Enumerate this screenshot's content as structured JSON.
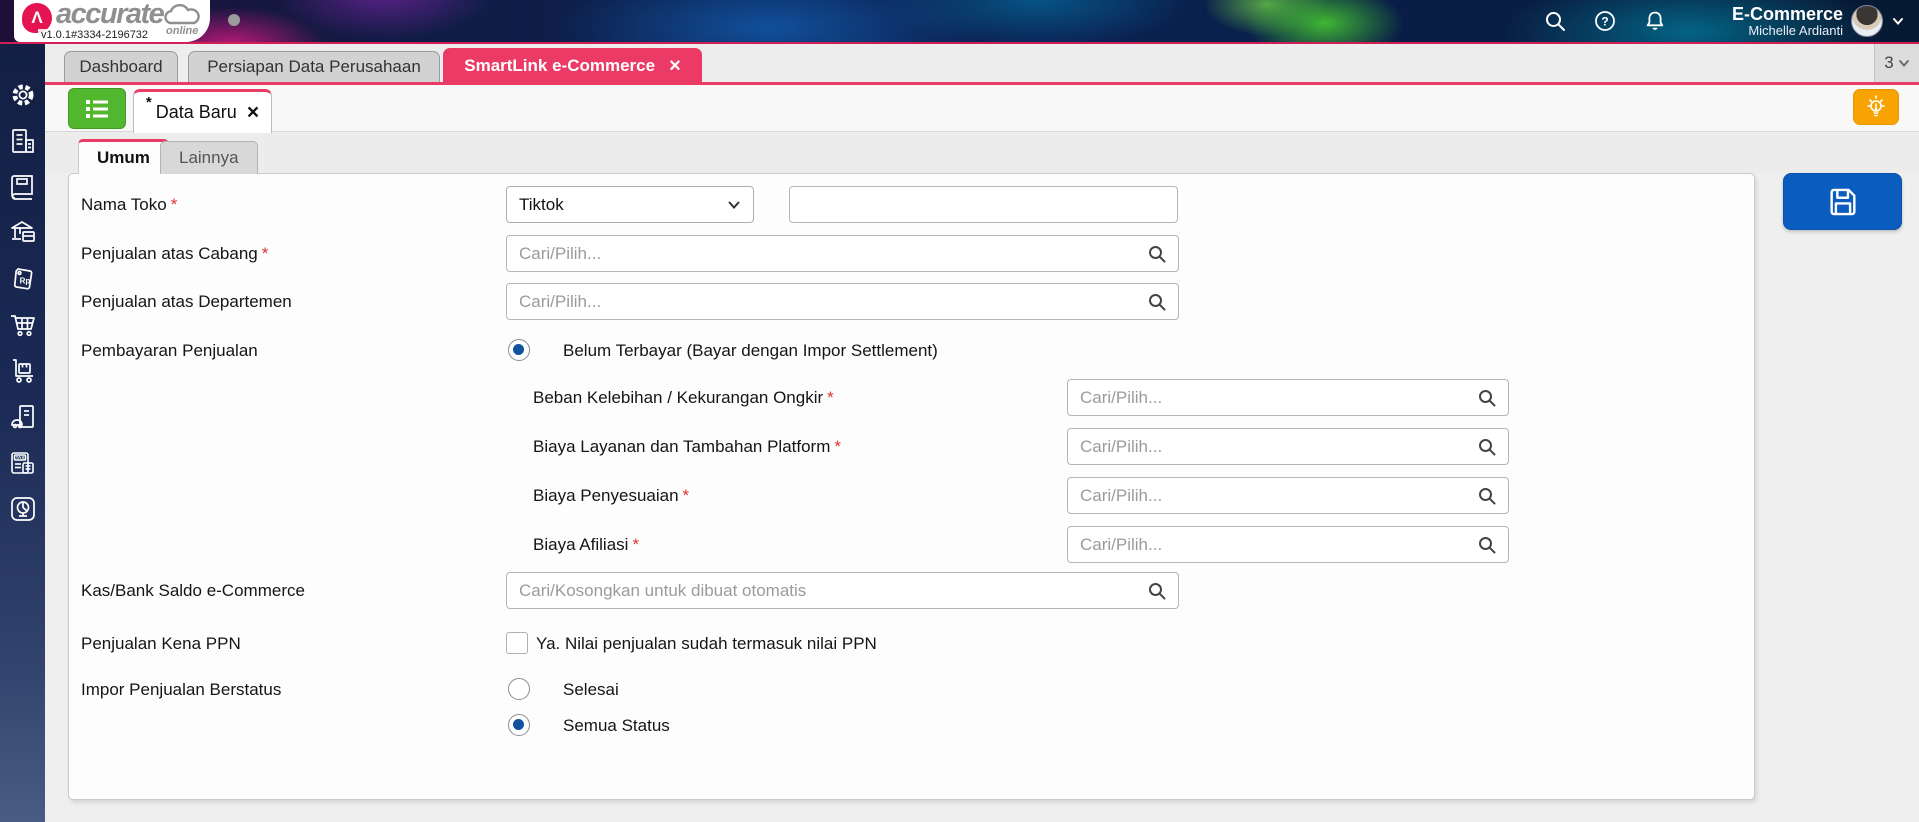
{
  "app": {
    "brand": "accurate",
    "brand_mark": "Λ",
    "brand_suffix": "online",
    "version": "v1.0.1#3334-2196732"
  },
  "topbar": {
    "workspace": "E-Commerce",
    "user": "Michelle Ardianti",
    "icons": [
      "search-icon",
      "help-icon",
      "notifications-icon",
      "user-menu-chevron"
    ]
  },
  "tabbar": {
    "tabs": [
      {
        "label": "Dashboard",
        "active": false
      },
      {
        "label": "Persiapan Data Perusahaan",
        "active": false
      },
      {
        "label": "SmartLink e-Commerce",
        "active": true,
        "close": "×"
      }
    ],
    "count": "3"
  },
  "docbar": {
    "list_button": "list-icon",
    "tab_dirty": "*",
    "tab_label": "Data Baru",
    "tab_close": "×",
    "hint_button": "lightbulb-icon"
  },
  "formtabs": {
    "umum": "Umum",
    "lainnya": "Lainnya"
  },
  "form": {
    "required_mark": "*",
    "nama_toko": {
      "label": "Nama Toko",
      "required": true,
      "dropdown_value": "Tiktok",
      "text_value": ""
    },
    "cabang": {
      "label": "Penjualan atas Cabang",
      "required": true,
      "placeholder": "Cari/Pilih..."
    },
    "departemen": {
      "label": "Penjualan atas Departemen",
      "required": false,
      "placeholder": "Cari/Pilih..."
    },
    "pembayaran": {
      "label": "Pembayaran Penjualan",
      "option": "Belum Terbayar (Bayar dengan Impor Settlement)",
      "selected": true
    },
    "beban_ongkir": {
      "label": "Beban Kelebihan / Kekurangan Ongkir",
      "required": true,
      "placeholder": "Cari/Pilih..."
    },
    "biaya_layanan": {
      "label": "Biaya Layanan dan Tambahan Platform",
      "required": true,
      "placeholder": "Cari/Pilih..."
    },
    "biaya_penyesuaian": {
      "label": "Biaya Penyesuaian",
      "required": true,
      "placeholder": "Cari/Pilih..."
    },
    "biaya_afiliasi": {
      "label": "Biaya Afiliasi",
      "required": true,
      "placeholder": "Cari/Pilih..."
    },
    "kas_bank": {
      "label": "Kas/Bank Saldo e-Commerce",
      "required": false,
      "placeholder": "Cari/Kosongkan untuk dibuat otomatis"
    },
    "ppn": {
      "label": "Penjualan Kena PPN",
      "option": "Ya. Nilai penjualan sudah termasuk nilai PPN",
      "checked": false
    },
    "impor_status": {
      "label": "Impor Penjualan Berstatus",
      "options": [
        {
          "label": "Selesai",
          "selected": false
        },
        {
          "label": "Semua Status",
          "selected": true
        }
      ]
    }
  },
  "sidebar": {
    "icons": [
      "settings",
      "company",
      "ledger",
      "banking",
      "currency-rp",
      "sales-cart",
      "inventory-trolley",
      "fixed-assets",
      "tax",
      "reports"
    ]
  },
  "colors": {
    "accent_pink": "#ec3a66",
    "green": "#50b72e",
    "orange": "#f9a303",
    "save_blue": "#0b5cbf",
    "radio_blue": "#11529e",
    "sidebar_top": "#131f44",
    "sidebar_bottom": "#4a5c83"
  }
}
